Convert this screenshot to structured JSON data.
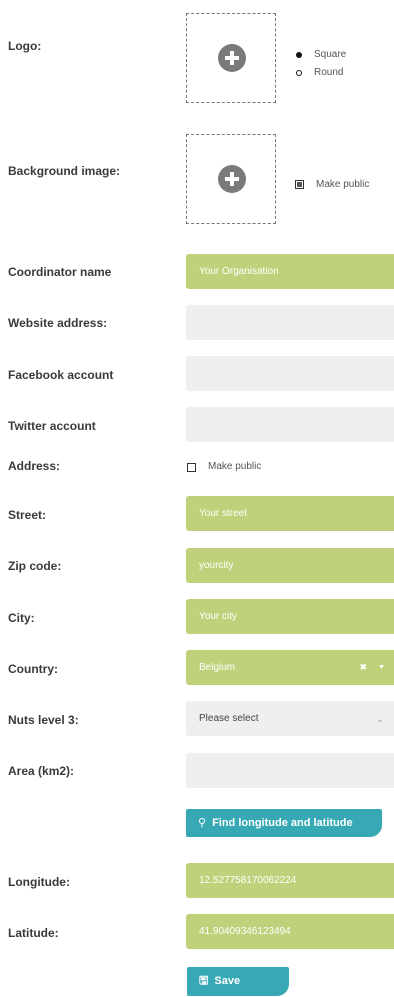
{
  "logo": {
    "label": "Logo:",
    "shape_options": [
      {
        "label": "Square",
        "selected": true
      },
      {
        "label": "Round",
        "selected": false
      }
    ]
  },
  "background_image": {
    "label": "Background image:",
    "make_public_label": "Make public",
    "make_public_checked": true
  },
  "coordinator_name": {
    "label": "Coordinator name",
    "value": "Your Organisation"
  },
  "website_address": {
    "label": "Website address:",
    "value": ""
  },
  "facebook_account": {
    "label": "Facebook account",
    "value": ""
  },
  "twitter_account": {
    "label": "Twitter account",
    "value": ""
  },
  "address": {
    "label": "Address:",
    "make_public_label": "Make public",
    "make_public_checked": false
  },
  "street": {
    "label": "Street:",
    "value": "Your street"
  },
  "zip_code": {
    "label": "Zip code:",
    "value": "yourcity"
  },
  "city": {
    "label": "City:",
    "value": "Your city"
  },
  "country": {
    "label": "Country:",
    "value": "Belgium"
  },
  "nuts_level_3": {
    "label": "Nuts level 3:",
    "value": "Please select"
  },
  "area": {
    "label": "Area (km2):",
    "value": ""
  },
  "find_button": {
    "label": "Find longitude and latitude",
    "icon": "map-pin-icon"
  },
  "longitude": {
    "label": "Longitude:",
    "value": "12.527758170062224"
  },
  "latitude": {
    "label": "Latitude:",
    "value": "41.90409346123494"
  },
  "save_button": {
    "label": "Save",
    "icon": "floppy-disk-icon"
  },
  "colors": {
    "field_green": "#bfd17a",
    "field_grey": "#efefef",
    "button_teal": "#37a9b5"
  }
}
